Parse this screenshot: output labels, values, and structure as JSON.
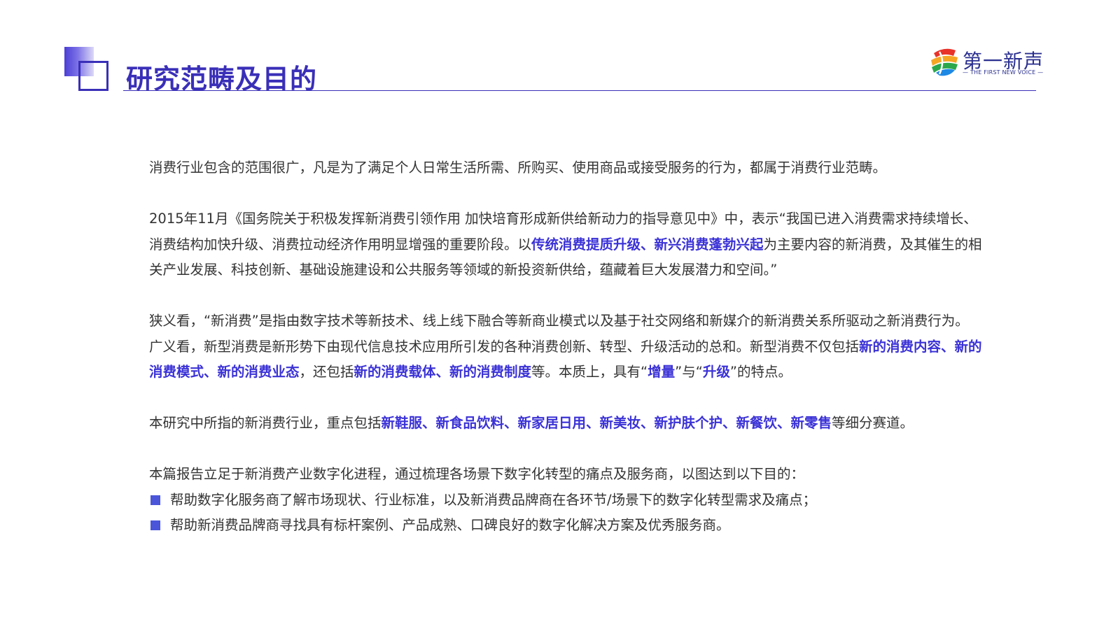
{
  "header": {
    "title": "研究范畴及目的"
  },
  "logo": {
    "name": "第一新声",
    "tagline": "— THE FIRST NEW VOICE —",
    "colors": [
      "#e8332a",
      "#f5a623",
      "#2ba84a",
      "#1e88e5",
      "#2a2f8f"
    ]
  },
  "colors": {
    "accent": "#3a2fb8",
    "highlight": "#3b32d6",
    "text": "#333333",
    "bullet": "#4a55d9"
  },
  "content": {
    "p1": {
      "t1": "消费行业包含的范围很广，凡是为了满足个人日常生活所需、所购买、使用商品或接受服务的行为，都属于消费行业范畴。"
    },
    "p2": {
      "t1": "2015年11月《国务院关于积极发挥新消费引领作用 加快培育形成新供给新动力的指导意见中》中，表示“我国已进入消费需求持续增长、消费结构加快升级、消费拉动经济作用明显增强的重要阶段。以",
      "h1": "传统消费提质升级、新兴消费蓬勃兴起",
      "t2": "为主要内容的新消费，及其催生的相关产业发展、科技创新、基础设施建设和公共服务等领域的新投资新供给，蕴藏着巨大发展潜力和空间。”"
    },
    "p3": {
      "t1": "狭义看，“新消费”是指由数字技术等新技术、线上线下融合等新商业模式以及基于社交网络和新媒介的新消费关系所驱动之新消费行为。广义看，新型消费是新形势下由现代信息技术应用所引发的各种消费创新、转型、升级活动的总和。新型消费不仅包括",
      "h1": "新的消费内容、新的消费模式、新的消费业态",
      "t2": "，还包括",
      "h2": "新的消费载体、新的消费制度",
      "t3": "等。本质上，具有“",
      "h3": "增量",
      "t4": "”与“",
      "h4": "升级",
      "t5": "”的特点。"
    },
    "p4": {
      "t1": "本研究中所指的新消费行业，重点包括",
      "h1": "新鞋服、新食品饮料、新家居日用、新美妆、新护肤个护、新餐饮、新零售",
      "t2": "等细分赛道。"
    },
    "p5": {
      "t1": "本篇报告立足于新消费产业数字化进程，通过梳理各场景下数字化转型的痛点及服务商，以图达到以下目的："
    },
    "bullets": [
      "帮助数字化服务商了解市场现状、行业标准，以及新消费品牌商在各环节/场景下的数字化转型需求及痛点；",
      "帮助新消费品牌商寻找具有标杆案例、产品成熟、口碑良好的数字化解决方案及优秀服务商。"
    ]
  }
}
